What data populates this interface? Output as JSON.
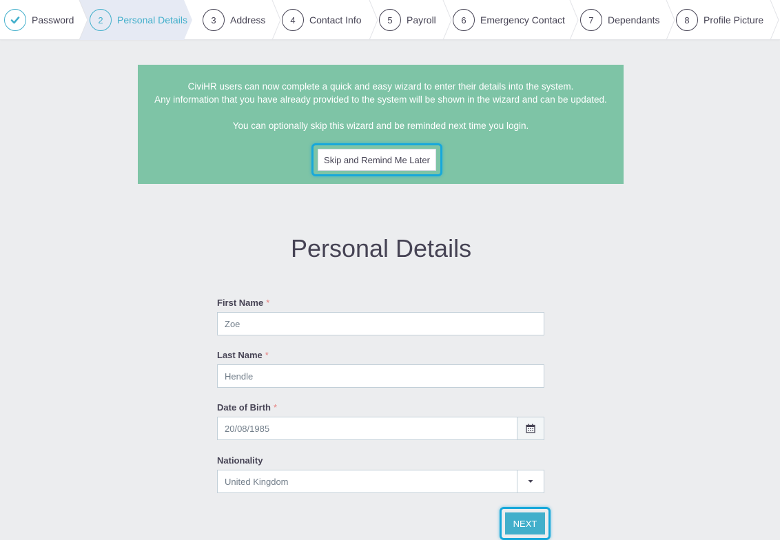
{
  "steps": [
    {
      "number": "1",
      "label": "Password",
      "state": "done"
    },
    {
      "number": "2",
      "label": "Personal Details",
      "state": "active"
    },
    {
      "number": "3",
      "label": "Address",
      "state": "todo"
    },
    {
      "number": "4",
      "label": "Contact Info",
      "state": "todo"
    },
    {
      "number": "5",
      "label": "Payroll",
      "state": "todo"
    },
    {
      "number": "6",
      "label": "Emergency Contact",
      "state": "todo"
    },
    {
      "number": "7",
      "label": "Dependants",
      "state": "todo"
    },
    {
      "number": "8",
      "label": "Profile Picture",
      "state": "todo"
    }
  ],
  "banner": {
    "line1": "CiviHR users can now complete a quick and easy wizard to enter their details into the system.",
    "line2": "Any information that you have already provided to the system will be shown in the wizard and can be updated.",
    "line3": "You can optionally skip this wizard and be reminded next time you login.",
    "skip_label": "Skip and Remind Me Later"
  },
  "form": {
    "title": "Personal Details",
    "required_mark": "*",
    "first_name": {
      "label": "First Name",
      "value": "Zoe"
    },
    "last_name": {
      "label": "Last Name",
      "value": "Hendle"
    },
    "dob": {
      "label": "Date of Birth",
      "value": "20/08/1985",
      "icon": "calendar-icon"
    },
    "nationality": {
      "label": "Nationality",
      "value": "United Kingdom",
      "icon": "caret-down-icon"
    },
    "next_label": "NEXT"
  },
  "colors": {
    "accent": "#42afcb",
    "banner": "#7ec4a6",
    "highlight": "#18a8da",
    "required": "#e6807f"
  }
}
